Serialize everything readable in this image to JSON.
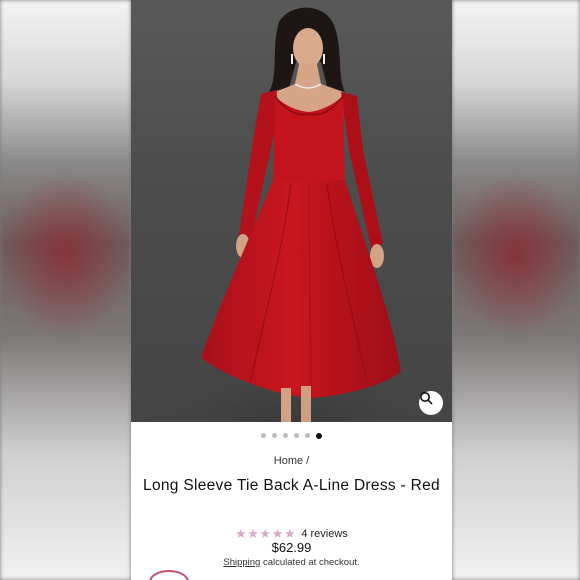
{
  "product": {
    "breadcrumb": "Home /",
    "title": "Long Sleeve Tie Back A-Line Dress - Red",
    "rating_value": 5,
    "rating_max": 5,
    "reviews": "4 reviews",
    "price": "$62.99",
    "shipping_text": "Shipping",
    "shipping_suffix": " calculated at checkout."
  },
  "gallery": {
    "image_count": 6,
    "active_index": 5,
    "zoom_icon": "search-icon"
  },
  "colors": {
    "dress_red": "#c0141e",
    "star_pink": "#d9a7c6",
    "backdrop_gray": "#4c4c4c"
  }
}
